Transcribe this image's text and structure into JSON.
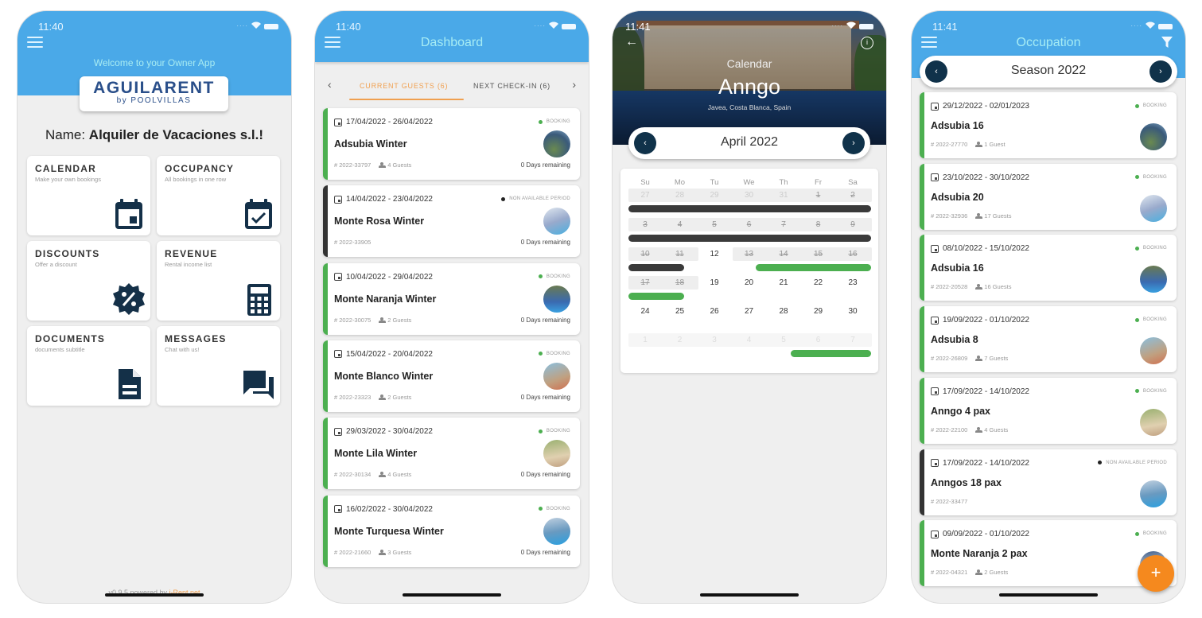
{
  "colors": {
    "header_blue": "#4aa9e8",
    "booking_green": "#4caf50",
    "nap_dark": "#333333",
    "accent_orange": "#f0a050",
    "fab_orange": "#f5891e",
    "nav_dark": "#10324a"
  },
  "home": {
    "time": "11:40",
    "welcome": "Welcome to your Owner App",
    "logo_main": "AGUILARENT",
    "logo_sub": "by POOLVILLAS",
    "name_label": "Name:",
    "name_value": "Alquiler de Vacaciones s.l.!",
    "tiles": [
      {
        "title": "CALENDAR",
        "subtitle": "Make your own bookings",
        "icon": "calendar-icon"
      },
      {
        "title": "OCCUPANCY",
        "subtitle": "All bookings in one row",
        "icon": "calendar-check-icon"
      },
      {
        "title": "DISCOUNTS",
        "subtitle": "Offer a discount",
        "icon": "discount-badge-icon"
      },
      {
        "title": "REVENUE",
        "subtitle": "Rental income list",
        "icon": "calculator-icon"
      },
      {
        "title": "DOCUMENTS",
        "subtitle": "documents subtitle",
        "icon": "document-icon"
      },
      {
        "title": "MESSAGES",
        "subtitle": "Chat with us!",
        "icon": "chat-icon"
      }
    ],
    "footer_version": "v0.9.5 powered by ",
    "footer_link": "i-Rent.net"
  },
  "dashboard": {
    "time": "11:40",
    "title": "Dashboard",
    "tabs": [
      {
        "label": "CURRENT GUESTS (6)",
        "active": true
      },
      {
        "label": "NEXT CHECK-IN (6)",
        "active": false
      }
    ],
    "prev_arrow": "‹",
    "next_arrow": "›",
    "bookings": [
      {
        "dates": "17/04/2022 - 26/04/2022",
        "status": "BOOKING",
        "name": "Adsubia Winter",
        "ref": "# 2022-33797",
        "guests": "4 Guests",
        "remaining": "0 Days remaining"
      },
      {
        "dates": "14/04/2022 - 23/04/2022",
        "status": "NON AVAILABLE PERIOD",
        "name": "Monte Rosa Winter",
        "ref": "# 2022-33905",
        "guests": "",
        "remaining": "0 Days remaining"
      },
      {
        "dates": "10/04/2022 - 29/04/2022",
        "status": "BOOKING",
        "name": "Monte Naranja Winter",
        "ref": "# 2022-30075",
        "guests": "2 Guests",
        "remaining": "0 Days remaining"
      },
      {
        "dates": "15/04/2022 - 20/04/2022",
        "status": "BOOKING",
        "name": "Monte Blanco Winter",
        "ref": "# 2022-23323",
        "guests": "2 Guests",
        "remaining": "0 Days remaining"
      },
      {
        "dates": "29/03/2022 - 30/04/2022",
        "status": "BOOKING",
        "name": "Monte Lila Winter",
        "ref": "# 2022-30134",
        "guests": "4 Guests",
        "remaining": "0 Days remaining"
      },
      {
        "dates": "16/02/2022 - 30/04/2022",
        "status": "BOOKING",
        "name": "Monte Turquesa Winter",
        "ref": "# 2022-21660",
        "guests": "3 Guests",
        "remaining": "0 Days remaining"
      }
    ]
  },
  "calendar": {
    "time": "11:41",
    "caption": "Calendar",
    "property": "Anngo",
    "location": "Javea, Costa Blanca, Spain",
    "month": "April 2022",
    "weekdays": [
      "Su",
      "Mo",
      "Tu",
      "We",
      "Th",
      "Fr",
      "Sa"
    ],
    "weeks": [
      [
        "27",
        "28",
        "29",
        "30",
        "31",
        "1",
        "2"
      ],
      [
        "3",
        "4",
        "5",
        "6",
        "7",
        "8",
        "9"
      ],
      [
        "10",
        "11",
        "12",
        "13",
        "14",
        "15",
        "16"
      ],
      [
        "17",
        "18",
        "19",
        "20",
        "21",
        "22",
        "23"
      ],
      [
        "24",
        "25",
        "26",
        "27",
        "28",
        "29",
        "30"
      ],
      [
        "1",
        "2",
        "3",
        "4",
        "5",
        "6",
        "7"
      ]
    ]
  },
  "occupation": {
    "time": "11:41",
    "title": "Occupation",
    "season": "Season 2022",
    "fab_label": "+",
    "bookings": [
      {
        "dates": "29/12/2022 - 02/01/2023",
        "status": "BOOKING",
        "name": "Adsubia 16",
        "ref": "# 2022-27770",
        "guests": "1 Guest"
      },
      {
        "dates": "23/10/2022 - 30/10/2022",
        "status": "BOOKING",
        "name": "Adsubia 20",
        "ref": "# 2022-32936",
        "guests": "17 Guests"
      },
      {
        "dates": "08/10/2022 - 15/10/2022",
        "status": "BOOKING",
        "name": "Adsubia 16",
        "ref": "# 2022-20528",
        "guests": "16 Guests"
      },
      {
        "dates": "19/09/2022 - 01/10/2022",
        "status": "BOOKING",
        "name": "Adsubia 8",
        "ref": "# 2022-26809",
        "guests": "7 Guests"
      },
      {
        "dates": "17/09/2022 - 14/10/2022",
        "status": "BOOKING",
        "name": "Anngo 4 pax",
        "ref": "# 2022-22100",
        "guests": "4 Guests"
      },
      {
        "dates": "17/09/2022 - 14/10/2022",
        "status": "NON AVAILABLE PERIOD",
        "name": "Anngos 18 pax",
        "ref": "# 2022-33477",
        "guests": ""
      },
      {
        "dates": "09/09/2022 - 01/10/2022",
        "status": "BOOKING",
        "name": "Monte Naranja 2 pax",
        "ref": "# 2022-04321",
        "guests": "2 Guests"
      }
    ]
  }
}
